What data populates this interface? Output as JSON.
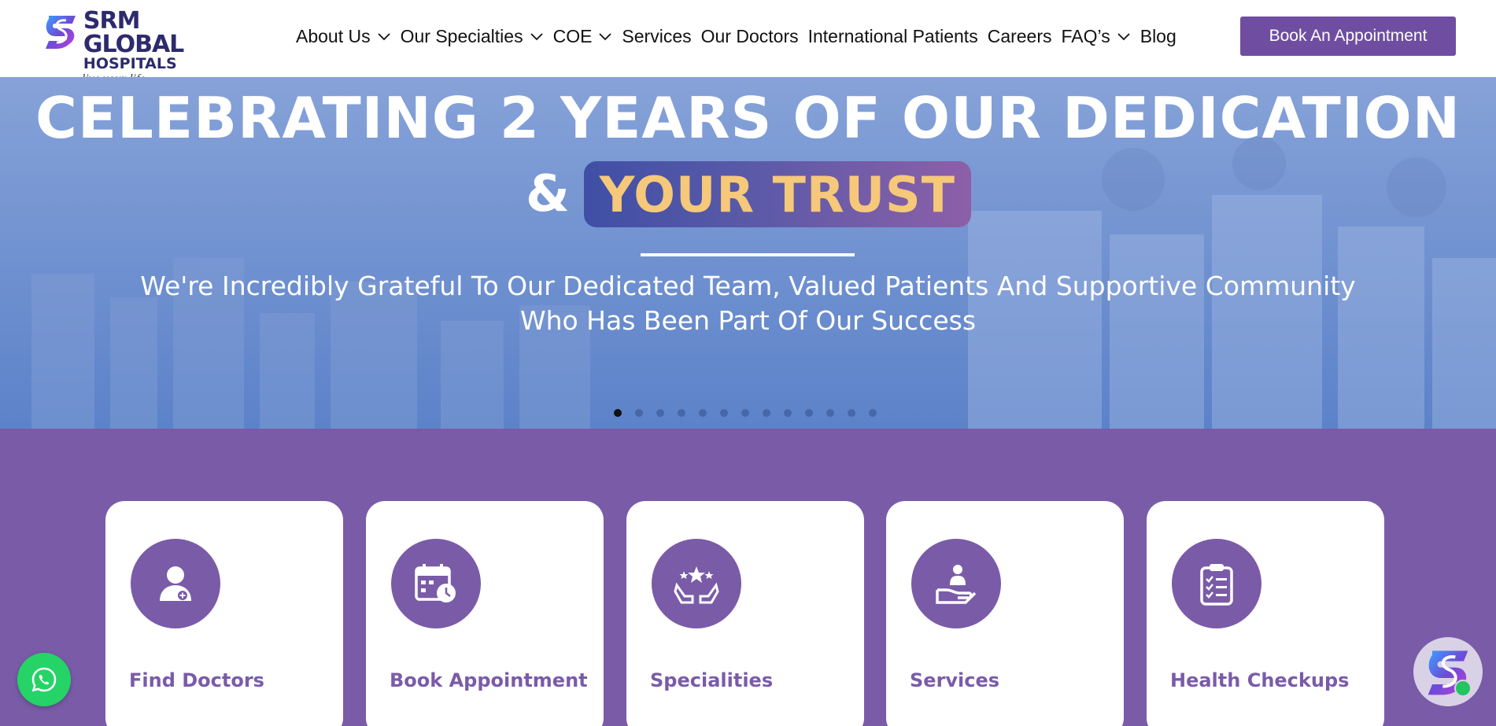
{
  "brand": {
    "line1": "SRM GLOBAL",
    "line2": "HOSPITALS",
    "tagline": "live your life.",
    "colors": {
      "primary": "#6f4ea1",
      "section_bg": "#7a5ba8",
      "navy": "#2d2a6e",
      "trust_text": "#f5c87a"
    }
  },
  "nav": {
    "items": [
      {
        "label": "About Us",
        "dropdown": true
      },
      {
        "label": "Our Specialties",
        "dropdown": true
      },
      {
        "label": "COE",
        "dropdown": true
      },
      {
        "label": "Services",
        "dropdown": false
      },
      {
        "label": "Our Doctors",
        "dropdown": false
      },
      {
        "label": "International Patients",
        "dropdown": false
      },
      {
        "label": "Careers",
        "dropdown": false
      },
      {
        "label": "FAQ’s",
        "dropdown": true
      },
      {
        "label": "Blog",
        "dropdown": false
      }
    ],
    "cta": "Book An Appointment"
  },
  "hero": {
    "title": "CELEBRATING 2 YEARS OF OUR DEDICATION",
    "amp": "&",
    "highlight": "YOUR TRUST",
    "subtitle_line1": "We're Incredibly Grateful To Our Dedicated Team, Valued Patients And Supportive Community",
    "subtitle_line2": "Who Has Been Part Of Our Success",
    "slide_count": 13,
    "active_slide": 1
  },
  "quick_links": [
    {
      "label": "Find Doctors",
      "icon": "doctor-icon"
    },
    {
      "label": "Book Appointment",
      "icon": "calendar-clock-icon"
    },
    {
      "label": "Specialities",
      "icon": "hands-stars-icon"
    },
    {
      "label": "Services",
      "icon": "care-hand-icon"
    },
    {
      "label": "Health Checkups",
      "icon": "clipboard-checklist-icon"
    }
  ],
  "floating": {
    "whatsapp_icon": "whatsapp-icon",
    "chat_icon": "chatbot-logo-icon"
  }
}
